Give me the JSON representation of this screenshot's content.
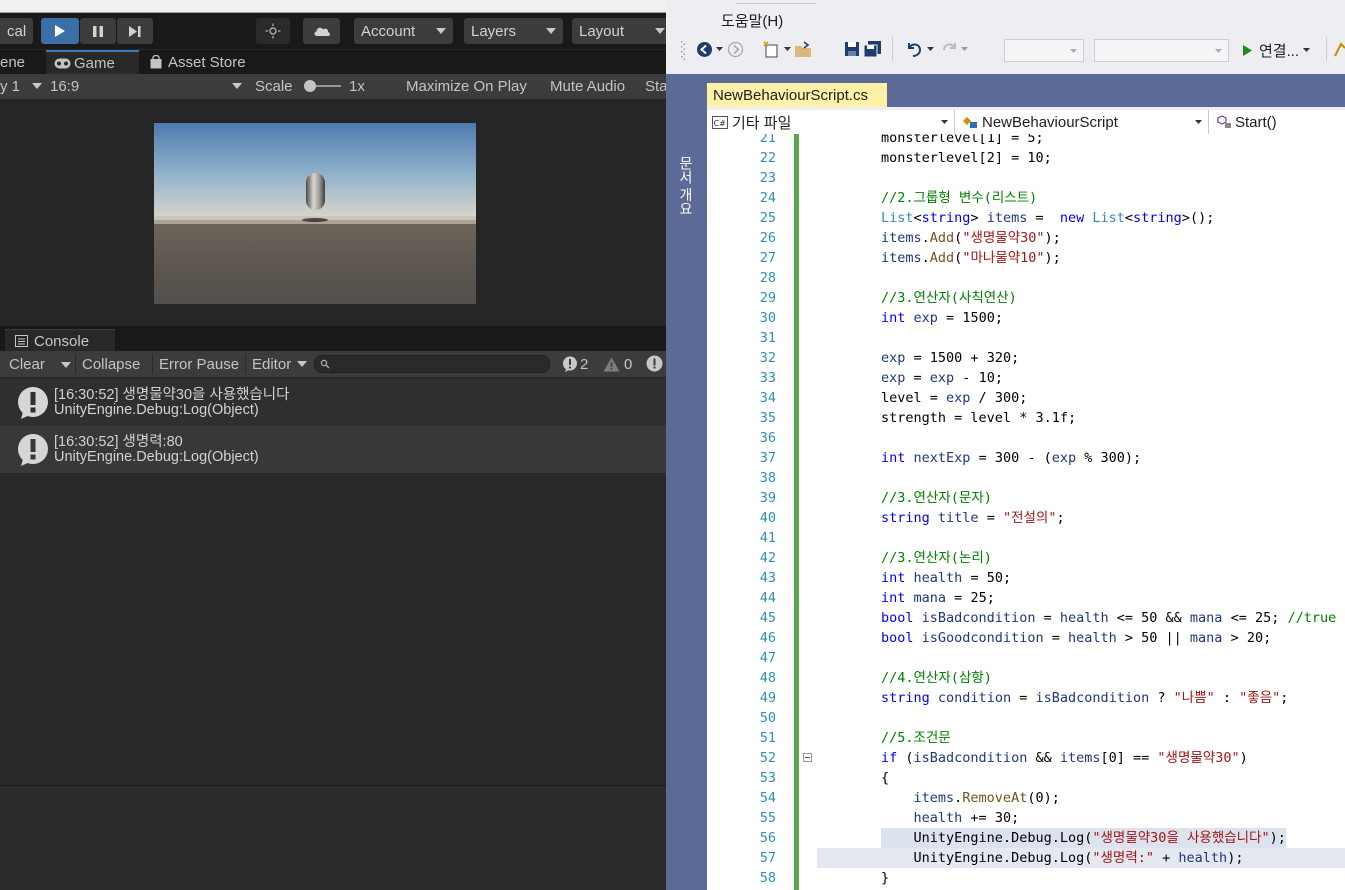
{
  "unity": {
    "toolbar": {
      "local_label": "cal",
      "account_label": "Account",
      "layers_label": "Layers",
      "layout_label": "Layout"
    },
    "tabs": {
      "scene": "ene",
      "game": "Game",
      "asset_store": "Asset Store"
    },
    "game_bar": {
      "display": "y 1",
      "aspect": "16:9",
      "scale_label": "Scale",
      "scale_value": "1x",
      "maximize": "Maximize On Play",
      "mute": "Mute Audio",
      "stats": "Sta"
    },
    "console": {
      "tab_label": "Console",
      "clear": "Clear",
      "collapse": "Collapse",
      "error_pause": "Error Pause",
      "editor": "Editor",
      "count_errors": "2",
      "count_warnings": "0",
      "logs": [
        {
          "line1": "[16:30:52] 생명물약30을 사용했습니다",
          "line2": "UnityEngine.Debug:Log(Object)"
        },
        {
          "line1": "[16:30:52] 생명력:80",
          "line2": "UnityEngine.Debug:Log(Object)"
        }
      ]
    }
  },
  "vs": {
    "menu_help": "도움말(H)",
    "connect_label": "연결...",
    "side_label": "문서 개요",
    "doc_tab": "NewBehaviourScript.cs",
    "nav": {
      "project": "기타 파일",
      "class": "NewBehaviourScript",
      "method": "Start()"
    },
    "line_numbers": [
      "21",
      "22",
      "23",
      "24",
      "25",
      "26",
      "27",
      "28",
      "29",
      "30",
      "31",
      "32",
      "33",
      "34",
      "35",
      "36",
      "37",
      "38",
      "39",
      "40",
      "41",
      "42",
      "43",
      "44",
      "45",
      "46",
      "47",
      "48",
      "49",
      "50",
      "51",
      "52",
      "53",
      "54",
      "55",
      "56",
      "57",
      "58"
    ],
    "code": [
      "monsterlevel[1] = 5;",
      "monsterlevel[2] = 10;",
      "",
      "//2.그룹형 변수(리스트)",
      "List<string> items =  new List<string>();",
      "items.Add(\"생명물약30\");",
      "items.Add(\"마나물약10\");",
      "",
      "//3.연산자(사칙연산)",
      "int exp = 1500;",
      "",
      "exp = 1500 + 320;",
      "exp = exp - 10;",
      "level = exp / 300;",
      "strength = level * 3.1f;",
      "",
      "int nextExp = 300 - (exp % 300);",
      "",
      "//3.연산자(문자)",
      "string title = \"전설의\";",
      "",
      "//3.연산자(논리)",
      "int health = 50;",
      "int mana = 25;",
      "bool isBadcondition = health <= 50 && mana <= 25; //true",
      "bool isGoodcondition = health > 50 || mana > 20;",
      "",
      "//4.연산자(삼항)",
      "string condition = isBadcondition ? \"나쁨\" : \"좋음\";",
      "",
      "//5.조건문",
      "if (isBadcondition && items[0] == \"생명물약30\")",
      "{",
      "    items.RemoveAt(0);",
      "    health += 30;",
      "    UnityEngine.Debug.Log(\"생명물약30을 사용했습니다\");",
      "    UnityEngine.Debug.Log(\"생명력:\" + health);",
      "}"
    ]
  }
}
